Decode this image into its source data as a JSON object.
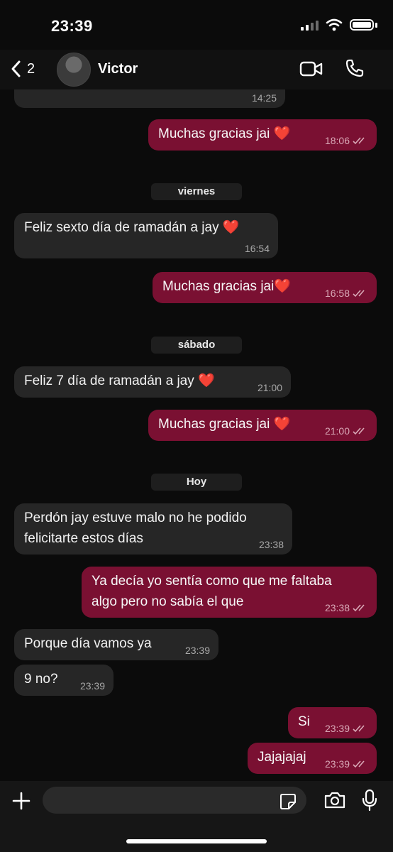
{
  "status_bar": {
    "time": "23:39"
  },
  "header": {
    "back_count": "2",
    "contact_name": "Victor"
  },
  "messages": [
    {
      "dir": "in",
      "text": "",
      "time": "14:25"
    },
    {
      "dir": "out",
      "text": "Muchas gracias jai",
      "emoji": "❤️",
      "time": "18:06"
    },
    {
      "dir": "day",
      "text": "viernes"
    },
    {
      "dir": "in",
      "text": "Feliz sexto día de ramadán a jay",
      "emoji": "❤️",
      "time": "16:54"
    },
    {
      "dir": "out",
      "text": "Muchas gracias jai",
      "emoji": "❤️",
      "time": "16:58"
    },
    {
      "dir": "day",
      "text": "sábado"
    },
    {
      "dir": "in",
      "text": "Feliz 7 día de ramadán a jay",
      "emoji": "❤️",
      "time": "21:00"
    },
    {
      "dir": "out",
      "text": "Muchas gracias jai",
      "emoji": "❤️",
      "time": "21:00"
    },
    {
      "dir": "day",
      "text": "Hoy"
    },
    {
      "dir": "in",
      "line1": "Perdón jay estuve malo no he podido",
      "line2": "felicitarte estos días",
      "time": "23:38"
    },
    {
      "dir": "out",
      "line1": "Ya decía yo sentía como que me faltaba",
      "line2": "algo pero no sabía el que",
      "time": "23:38"
    },
    {
      "dir": "in",
      "text": "Porque día vamos ya",
      "time": "23:39"
    },
    {
      "dir": "in",
      "text": "9 no?",
      "time": "23:39"
    },
    {
      "dir": "out",
      "text": "Si",
      "time": "23:39"
    },
    {
      "dir": "out",
      "text": "Jajajajaj",
      "time": "23:39"
    }
  ],
  "colors": {
    "incoming": "#262626",
    "outgoing": "#7a1032",
    "background": "#0b0b0b"
  },
  "icons": [
    "back-chevron-icon",
    "video-call-icon",
    "phone-icon",
    "plus-icon",
    "sticker-icon",
    "camera-icon",
    "microphone-icon",
    "read-ticks-icon"
  ]
}
